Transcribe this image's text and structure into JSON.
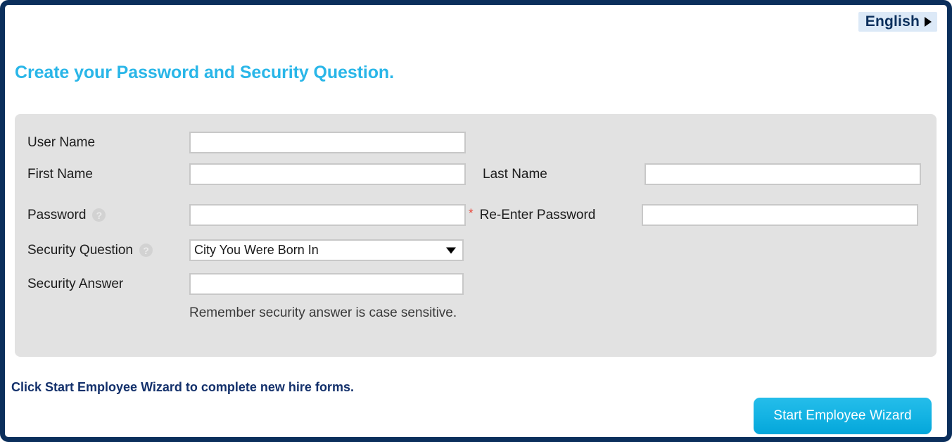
{
  "header": {
    "language_label": "English",
    "language_caret_icon": "caret-right-icon"
  },
  "page_title": "Create your Password and Security Question.",
  "form": {
    "help_icon_glyph": "?",
    "required_marker": "*",
    "dropdown_caret_icon": "caret-down-icon",
    "fields": {
      "user_name": {
        "label": "User Name",
        "value": "",
        "placeholder": ""
      },
      "first_name": {
        "label": "First Name",
        "value": "",
        "placeholder": ""
      },
      "last_name": {
        "label": "Last Name",
        "value": "",
        "placeholder": ""
      },
      "password": {
        "label": "Password",
        "value": "",
        "placeholder": ""
      },
      "reenter_password": {
        "label": "Re-Enter Password",
        "value": "",
        "placeholder": ""
      },
      "security_question": {
        "label": "Security Question",
        "selected": "City You Were Born In",
        "options": [
          "City You Were Born In"
        ]
      },
      "security_answer": {
        "label": "Security Answer",
        "value": "",
        "placeholder": ""
      }
    },
    "hint": "Remember security answer is case sensitive."
  },
  "footer": {
    "note": "Click Start Employee Wizard to complete new hire forms.",
    "wizard_button": "Start Employee Wizard"
  },
  "colors": {
    "border": "#0b2f5c",
    "title": "#29b6e8",
    "panel": "#e2e2e2",
    "button": "#14b3e3",
    "note": "#13306b",
    "required": "#e8463a"
  }
}
